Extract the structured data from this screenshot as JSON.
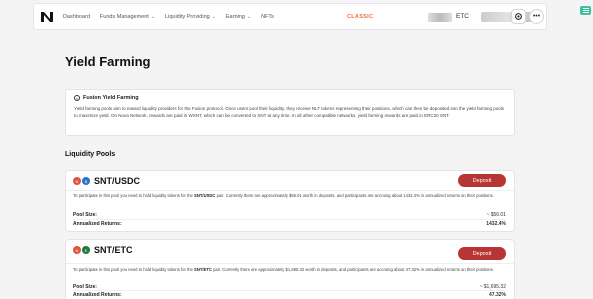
{
  "nav": {
    "items": [
      {
        "label": "Dashboard",
        "dropdown": false
      },
      {
        "label": "Funds Management",
        "dropdown": true
      },
      {
        "label": "Liquidity Providing",
        "dropdown": true
      },
      {
        "label": "Earning",
        "dropdown": true
      },
      {
        "label": "NFTs",
        "dropdown": false
      }
    ],
    "mode": "CLASSIC",
    "token": "ETC",
    "more": "•••"
  },
  "page_title": "Yield Farming",
  "info": {
    "title": "Fusion Yield Farming",
    "body": "Yield farming pools aim to reward liquidity providers for the Fusion protocol. Once users pool their liquidity, they receive NLT tokens representing their positions, which can then be deposited into the yield farming pools to maximize yield. On Nova Network, rewards are paid in WSNT, which can be converted to SNT at any time. In all other compatible networks, yield farming rewards are paid in ERC20 SNT."
  },
  "section_title": "Liquidity Pools",
  "pools": [
    {
      "name": "SNT/USDC",
      "desc_pre": "To participate in this pool you need to hold liquidity tokens for the ",
      "desc_pair": "SNT/USDC",
      "desc_post": " pair. Currently there are approximately $56.01 worth in deposits, and participants are accruing about 1432.4% in annualized returns on their positions.",
      "deposit_label": "Deposit",
      "pool_size_label": "Pool Size:",
      "pool_size": "~ $56.01",
      "returns_label": "Annualized Returns:",
      "returns": "1432.4%",
      "coin1_color": "#e0533d",
      "coin2_color": "#2775ca"
    },
    {
      "name": "SNT/ETC",
      "desc_pre": "To participate in this pool you need to hold liquidity tokens for the ",
      "desc_pair": "SNT/ETC",
      "desc_post": " pair. Currently there are approximately $1,695.32 worth in deposits, and participants are accruing about 47.32% in annualized returns on their positions.",
      "deposit_label": "Deposit",
      "pool_size_label": "Pool Size:",
      "pool_size": "~ $1,695.32",
      "returns_label": "Annualized Returns:",
      "returns": "47.32%",
      "coin1_color": "#e0533d",
      "coin2_color": "#1d7a3e"
    }
  ]
}
